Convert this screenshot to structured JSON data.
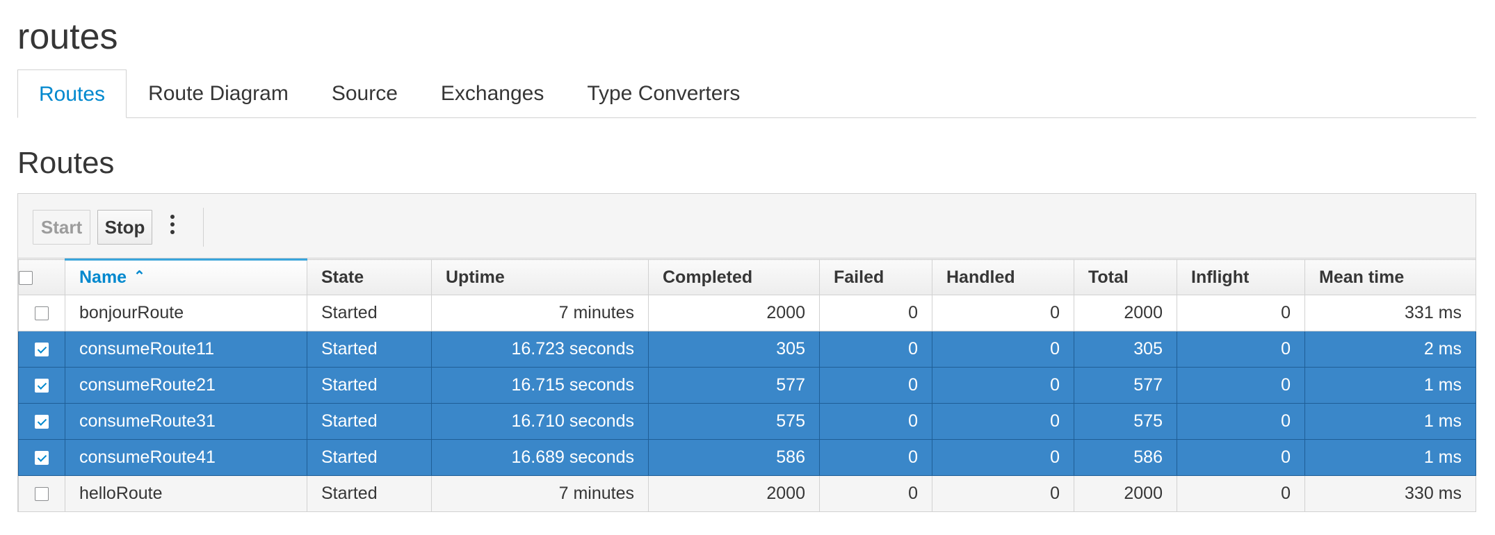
{
  "page": {
    "title": "routes"
  },
  "tabs": [
    {
      "label": "Routes",
      "active": true
    },
    {
      "label": "Route Diagram",
      "active": false
    },
    {
      "label": "Source",
      "active": false
    },
    {
      "label": "Exchanges",
      "active": false
    },
    {
      "label": "Type Converters",
      "active": false
    }
  ],
  "section": {
    "title": "Routes"
  },
  "toolbar": {
    "start_label": "Start",
    "stop_label": "Stop",
    "more_icon": "kebab-icon"
  },
  "table": {
    "columns": [
      "Name",
      "State",
      "Uptime",
      "Completed",
      "Failed",
      "Handled",
      "Total",
      "Inflight",
      "Mean time"
    ],
    "sort": {
      "column": "Name",
      "direction": "ascending",
      "icon": "chevron-up-icon"
    },
    "rows": [
      {
        "selected": false,
        "name": "bonjourRoute",
        "state": "Started",
        "uptime": "7 minutes",
        "completed": "2000",
        "failed": "0",
        "handled": "0",
        "total": "2000",
        "inflight": "0",
        "mean_time": "331 ms"
      },
      {
        "selected": true,
        "name": "consumeRoute11",
        "state": "Started",
        "uptime": "16.723 seconds",
        "completed": "305",
        "failed": "0",
        "handled": "0",
        "total": "305",
        "inflight": "0",
        "mean_time": "2 ms"
      },
      {
        "selected": true,
        "name": "consumeRoute21",
        "state": "Started",
        "uptime": "16.715 seconds",
        "completed": "577",
        "failed": "0",
        "handled": "0",
        "total": "577",
        "inflight": "0",
        "mean_time": "1 ms"
      },
      {
        "selected": true,
        "name": "consumeRoute31",
        "state": "Started",
        "uptime": "16.710 seconds",
        "completed": "575",
        "failed": "0",
        "handled": "0",
        "total": "575",
        "inflight": "0",
        "mean_time": "1 ms"
      },
      {
        "selected": true,
        "name": "consumeRoute41",
        "state": "Started",
        "uptime": "16.689 seconds",
        "completed": "586",
        "failed": "0",
        "handled": "0",
        "total": "586",
        "inflight": "0",
        "mean_time": "1 ms"
      },
      {
        "selected": false,
        "name": "helloRoute",
        "state": "Started",
        "uptime": "7 minutes",
        "completed": "2000",
        "failed": "0",
        "handled": "0",
        "total": "2000",
        "inflight": "0",
        "mean_time": "330 ms"
      }
    ]
  },
  "colors": {
    "accent": "#0088ce",
    "selected_row": "#3a87c9",
    "border": "#d1d1d1"
  }
}
